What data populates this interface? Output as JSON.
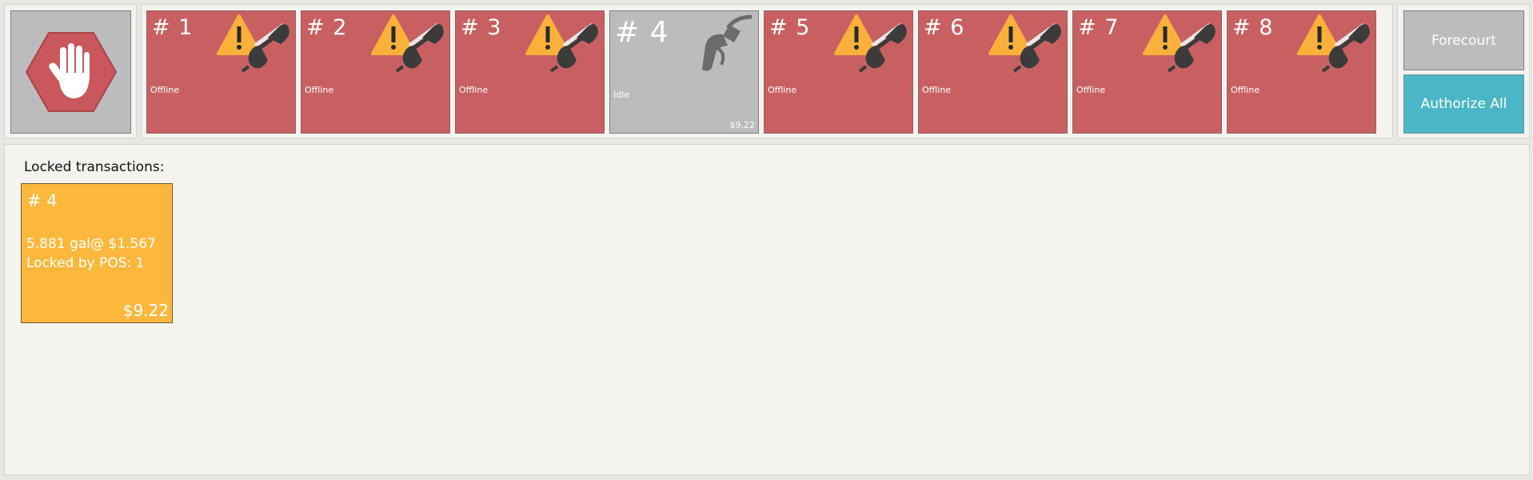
{
  "emergency_stop": {
    "icon": "stop-hand-icon"
  },
  "pumps": [
    {
      "number": "# 1",
      "status": "Offline",
      "amount": "",
      "state": "offline",
      "icon": "offline-warning-icon"
    },
    {
      "number": "# 2",
      "status": "Offline",
      "amount": "",
      "state": "offline",
      "icon": "offline-warning-icon"
    },
    {
      "number": "# 3",
      "status": "Offline",
      "amount": "",
      "state": "offline",
      "icon": "offline-warning-icon"
    },
    {
      "number": "# 4",
      "status": "Idle",
      "amount": "$9.22",
      "state": "idle",
      "icon": "fuel-nozzle-icon"
    },
    {
      "number": "# 5",
      "status": "Offline",
      "amount": "",
      "state": "offline",
      "icon": "offline-warning-icon"
    },
    {
      "number": "# 6",
      "status": "Offline",
      "amount": "",
      "state": "offline",
      "icon": "offline-warning-icon"
    },
    {
      "number": "# 7",
      "status": "Offline",
      "amount": "",
      "state": "offline",
      "icon": "offline-warning-icon"
    },
    {
      "number": "# 8",
      "status": "Offline",
      "amount": "",
      "state": "offline",
      "icon": "offline-warning-icon"
    }
  ],
  "side": {
    "forecourt_label": "Forecourt",
    "authorize_all_label": "Authorize All"
  },
  "locked": {
    "title": "Locked transactions:",
    "transactions": [
      {
        "pump": "# 4",
        "line1": "5.881 gal@ $1.567",
        "line2": "Locked by POS: 1",
        "amount": "$9.22"
      }
    ]
  },
  "colors": {
    "offline": "#c86062",
    "idle": "#bcbcbf",
    "authorize": "#4bb6c7",
    "locked_card": "#fbb83d",
    "warning": "#fbb03b"
  }
}
